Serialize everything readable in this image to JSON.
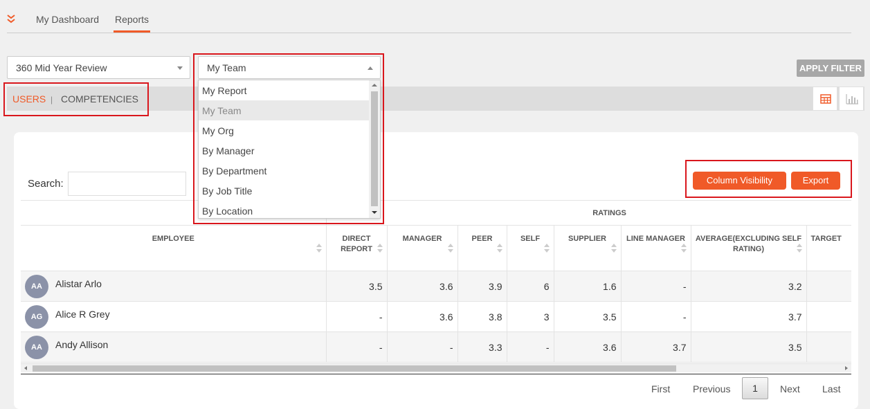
{
  "nav": {
    "tabs": [
      {
        "label": "My Dashboard"
      },
      {
        "label": "Reports"
      }
    ],
    "active_tab": "Reports"
  },
  "filters": {
    "review_select": {
      "value": "360 Mid Year Review"
    },
    "scope_select": {
      "value": "My Team",
      "open": true,
      "options": [
        "My Report",
        "My Team",
        "My Org",
        "By Manager",
        "By Department",
        "By Job Title",
        "By Location"
      ],
      "selected_index": 1
    },
    "apply_label": "APPLY FILTER"
  },
  "view_tabs": {
    "users": "USERS",
    "separator": "|",
    "competencies": "COMPETENCIES",
    "active": "USERS"
  },
  "view_toggles": [
    {
      "icon": "table-icon",
      "active": true
    },
    {
      "icon": "bar-chart-icon",
      "active": false
    }
  ],
  "search": {
    "label": "Search:",
    "value": ""
  },
  "actions": {
    "column_visibility": "Column Visibility",
    "export": "Export"
  },
  "table": {
    "group_header": "RATINGS",
    "columns": [
      "EMPLOYEE",
      "DIRECT REPORT",
      "MANAGER",
      "PEER",
      "SELF",
      "SUPPLIER",
      "LINE MANAGER",
      "AVERAGE(EXCLUDING SELF RATING)",
      "TARGET"
    ],
    "rows": [
      {
        "initials": "AA",
        "name": "Alistar Arlo",
        "values": [
          "3.5",
          "3.6",
          "3.9",
          "6",
          "1.6",
          "-",
          "3.2"
        ]
      },
      {
        "initials": "AG",
        "name": "Alice R Grey",
        "values": [
          "-",
          "3.6",
          "3.8",
          "3",
          "3.5",
          "-",
          "3.7"
        ]
      },
      {
        "initials": "AA",
        "name": "Andy Allison",
        "values": [
          "-",
          "-",
          "3.3",
          "-",
          "3.6",
          "3.7",
          "3.5"
        ]
      }
    ]
  },
  "pagination": {
    "first": "First",
    "previous": "Previous",
    "current": "1",
    "next": "Next",
    "last": "Last"
  },
  "colors": {
    "accent": "#f05a28",
    "highlight_box": "#d9161c",
    "avatar": "#8b92a8"
  }
}
